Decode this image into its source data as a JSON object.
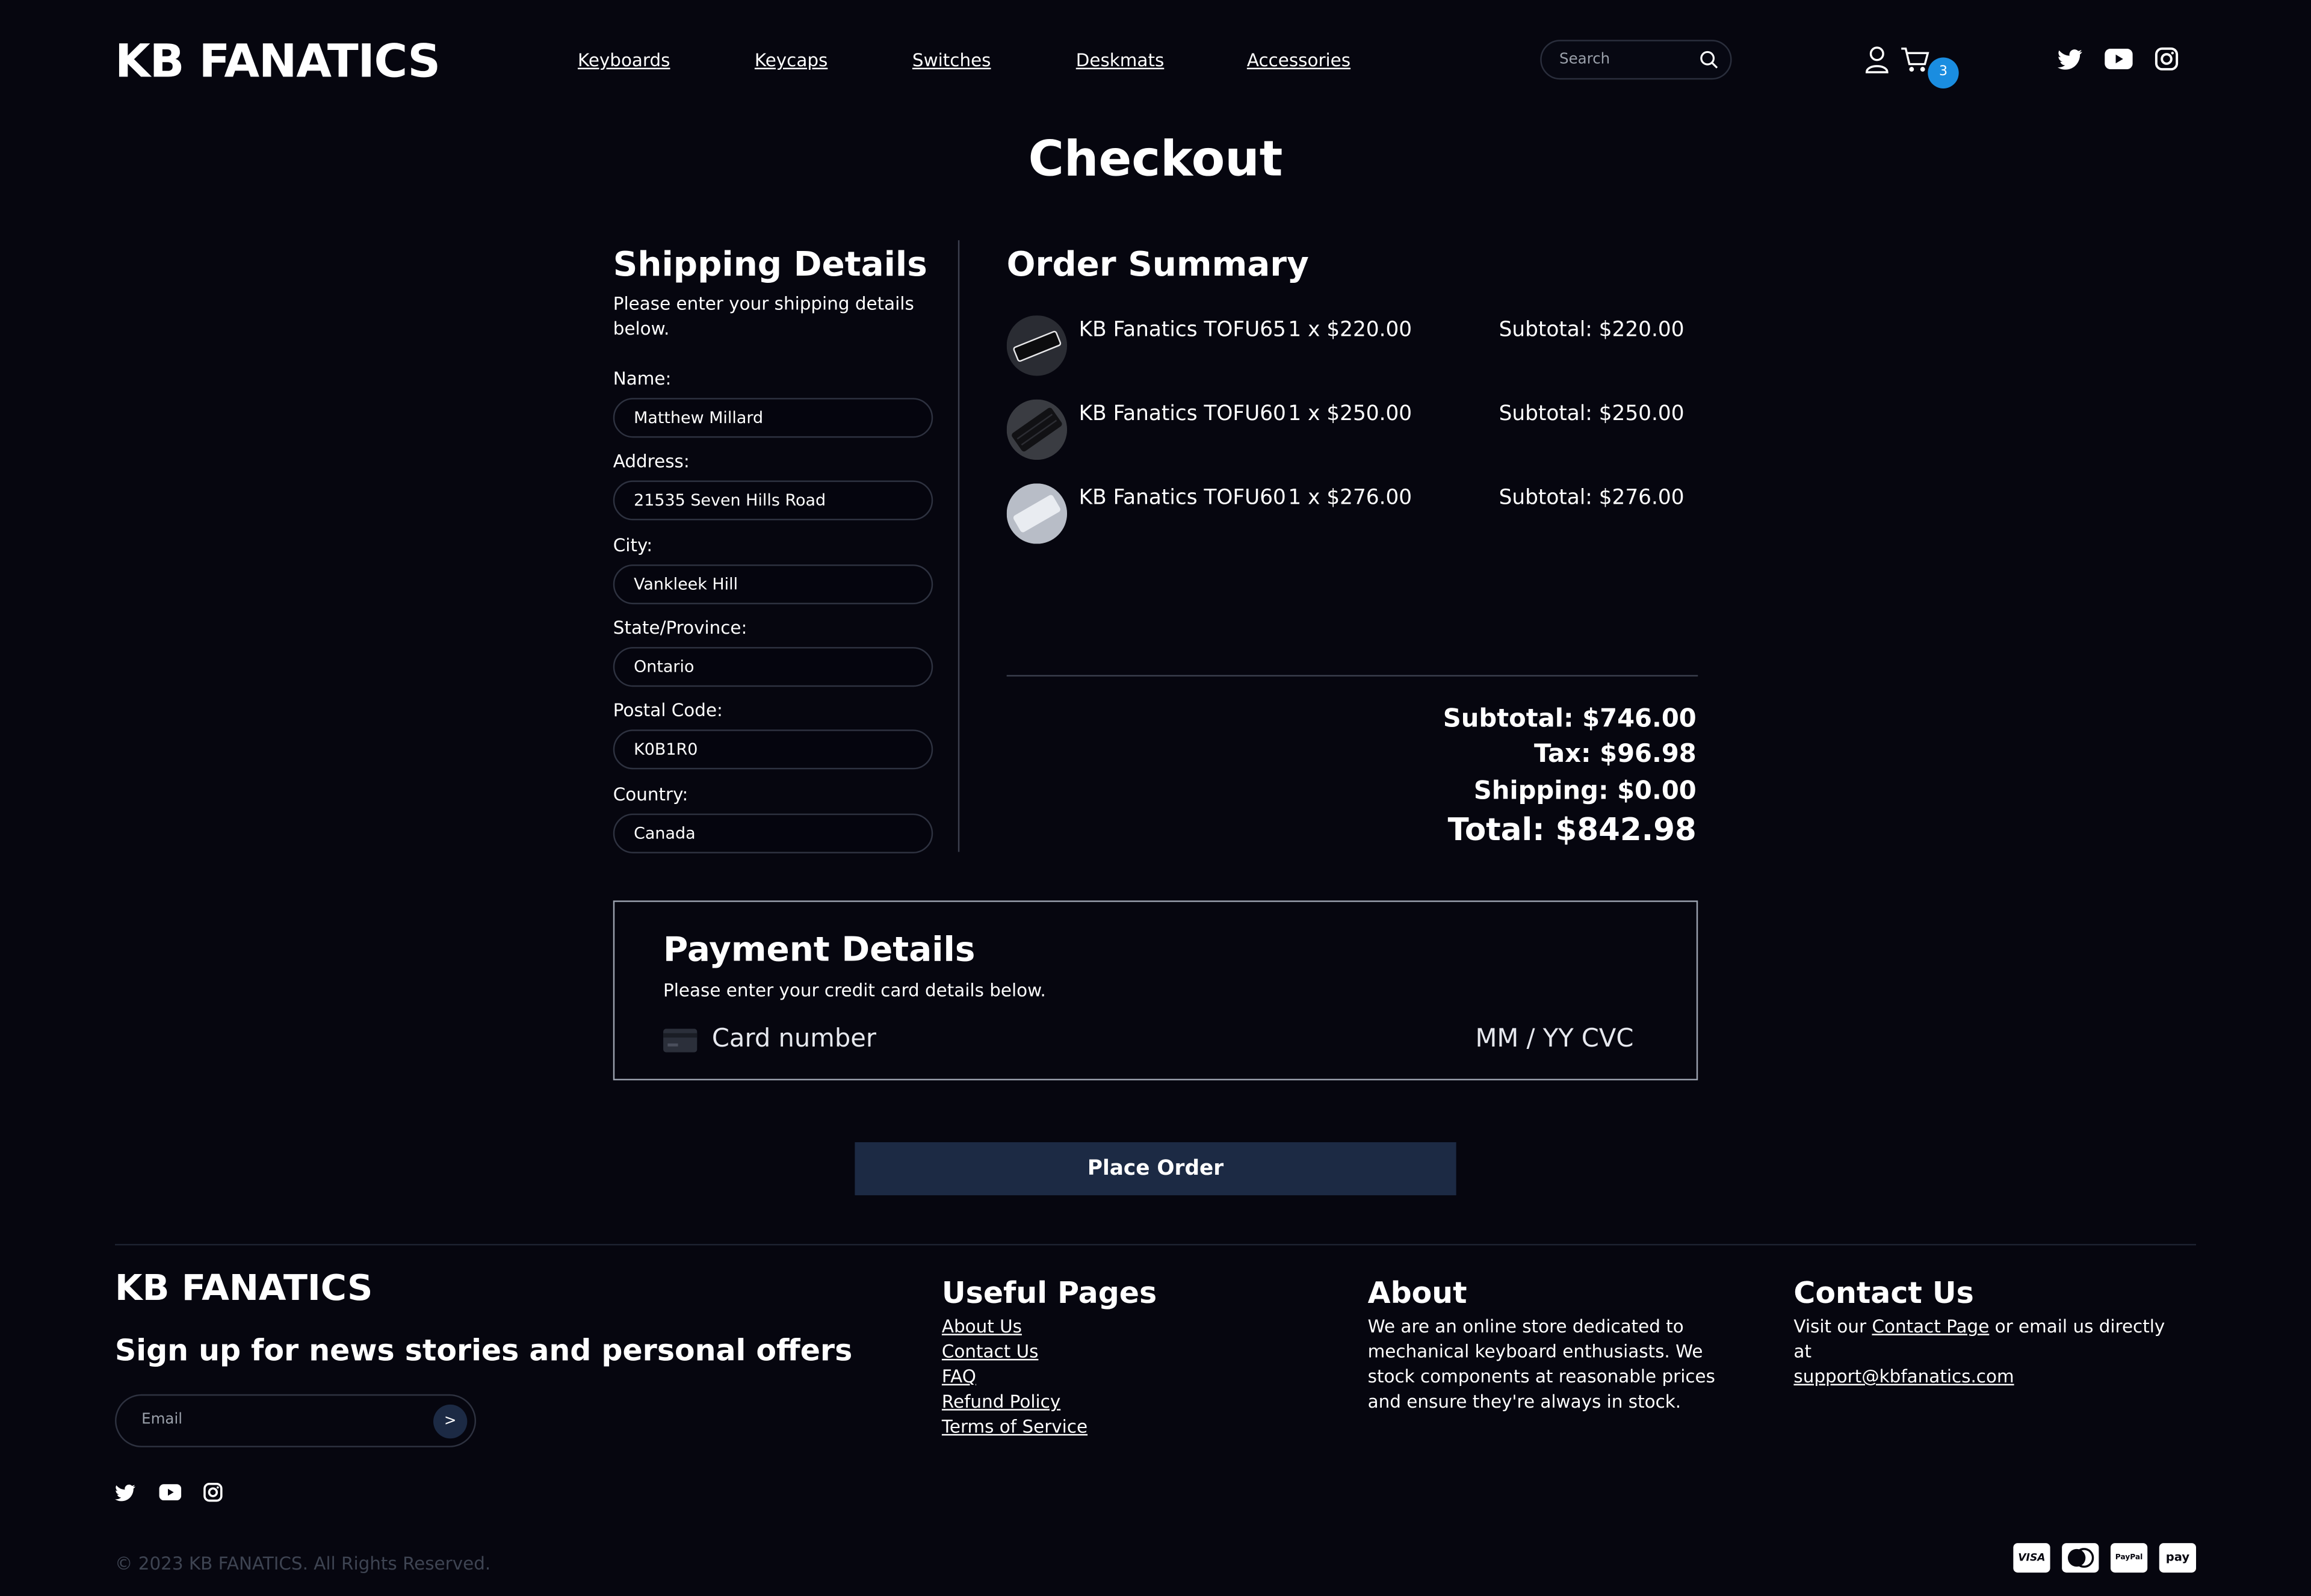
{
  "header": {
    "logo": "KB FANATICS",
    "nav": [
      "Keyboards",
      "Keycaps",
      "Switches",
      "Deskmats",
      "Accessories"
    ],
    "search_placeholder": "Search",
    "cart_count": "3",
    "icons": [
      "user-icon",
      "cart-icon",
      "twitter-icon",
      "youtube-icon",
      "instagram-icon"
    ]
  },
  "page_title": "Checkout",
  "shipping": {
    "title": "Shipping Details",
    "subtitle": "Please enter your shipping details below.",
    "fields": [
      {
        "label": "Name:",
        "value": "Matthew Millard"
      },
      {
        "label": "Address:",
        "value": "21535 Seven Hills Road"
      },
      {
        "label": "City:",
        "value": "Vankleek Hill"
      },
      {
        "label": "State/Province:",
        "value": "Ontario"
      },
      {
        "label": "Postal Code:",
        "value": "K0B1R0"
      },
      {
        "label": "Country:",
        "value": "Canada"
      }
    ]
  },
  "order": {
    "title": "Order Summary",
    "items": [
      {
        "name": "KB Fanatics TOFU65",
        "qty": "1 x $220.00",
        "subtotal": "Subtotal: $220.00"
      },
      {
        "name": "KB Fanatics TOFU60",
        "qty": "1 x $250.00",
        "subtotal": "Subtotal: $250.00"
      },
      {
        "name": "KB Fanatics TOFU60",
        "qty": "1 x $276.00",
        "subtotal": "Subtotal: $276.00"
      }
    ],
    "subtotal": "Subtotal: $746.00",
    "tax": "Tax: $96.98",
    "shipping": "Shipping: $0.00",
    "total": "Total: $842.98"
  },
  "payment": {
    "title": "Payment Details",
    "subtitle": "Please enter your credit card details below.",
    "card_placeholder": "Card number",
    "expiry_placeholder": "MM / YY",
    "cvc_placeholder": "CVC"
  },
  "place_order": "Place Order",
  "footer": {
    "logo": "KB FANATICS",
    "signup_title": "Sign up for news stories and personal offers",
    "email_placeholder": "Email",
    "submit": ">",
    "useful_title": "Useful Pages",
    "useful_links": [
      "About Us",
      "Contact Us",
      "FAQ",
      "Refund Policy",
      "Terms of Service"
    ],
    "about_title": "About",
    "about_text": "We are an online store dedicated to mechanical keyboard enthusiasts. We stock components at reasonable prices and ensure they're always in stock.",
    "contact_title": "Contact Us",
    "contact_pre": "Visit our ",
    "contact_link": "Contact Page",
    "contact_mid": " or email us directly at",
    "contact_email": "support@kbfanatics.com",
    "copyright": "© 2023 KB FANATICS. All Rights Reserved.",
    "payment_methods": [
      "VISA",
      "Mastercard",
      "PayPal",
      "pay"
    ]
  }
}
